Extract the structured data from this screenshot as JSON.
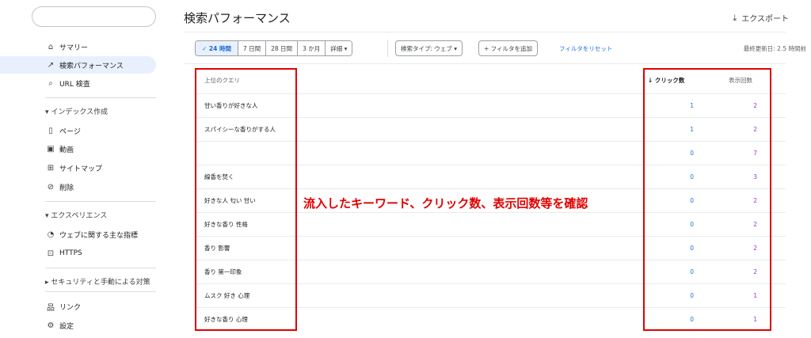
{
  "sidebar": {
    "search_placeholder": "",
    "items": [
      {
        "id": "summary",
        "label": "サマリー",
        "icon": "home-icon",
        "glyph": "⌂"
      },
      {
        "id": "performance",
        "label": "検索パフォーマンス",
        "icon": "trending-icon",
        "glyph": "↗"
      },
      {
        "id": "url-inspection",
        "label": "URL 検査",
        "icon": "search-icon",
        "glyph": "⌕"
      }
    ],
    "indexing": {
      "title": "インデックス作成",
      "items": [
        {
          "id": "pages",
          "label": "ページ",
          "icon": "pages-icon",
          "glyph": "▯"
        },
        {
          "id": "video",
          "label": "動画",
          "icon": "video-icon",
          "glyph": "▣"
        },
        {
          "id": "sitemaps",
          "label": "サイトマップ",
          "icon": "sitemap-icon",
          "glyph": "⊞"
        },
        {
          "id": "removals",
          "label": "削除",
          "icon": "removal-icon",
          "glyph": "⊘"
        }
      ]
    },
    "experience": {
      "title": "エクスペリエンス",
      "items": [
        {
          "id": "cwv",
          "label": "ウェブに関する主な指標",
          "icon": "gauge-icon",
          "glyph": "◔"
        },
        {
          "id": "https",
          "label": "HTTPS",
          "icon": "lock-icon",
          "glyph": "⊡"
        }
      ]
    },
    "security": {
      "title": "セキュリティと手動による対策"
    },
    "bottom": [
      {
        "id": "links",
        "label": "リンク",
        "icon": "links-icon",
        "glyph": "品"
      },
      {
        "id": "settings",
        "label": "設定",
        "icon": "gear-icon",
        "glyph": "⚙"
      }
    ]
  },
  "header": {
    "title": "検索パフォーマンス",
    "export_label": "エクスポート",
    "export_icon": "download-icon"
  },
  "filters": {
    "date_ranges": [
      "24 時間",
      "7 日間",
      "28 日間",
      "3 か月",
      "詳細"
    ],
    "selected_range": "24 時間",
    "search_type": "検索タイプ: ウェブ",
    "add_filter": "フィルタを追加",
    "reset": "フィルタをリセット",
    "last_updated": "最終更新日: 2.5 時間前"
  },
  "table": {
    "headers": {
      "query": "上位のクエリ",
      "clicks": "クリック数",
      "impressions": "表示回数"
    },
    "rows": [
      {
        "query": "甘い香りが好きな人",
        "clicks": "1",
        "impressions": "2"
      },
      {
        "query": "スパイシーな香りがする人",
        "clicks": "1",
        "impressions": "2"
      },
      {
        "query": "",
        "clicks": "0",
        "impressions": "7"
      },
      {
        "query": "線香を焚く",
        "clicks": "0",
        "impressions": "3"
      },
      {
        "query": "好きな人 匂い 甘い",
        "clicks": "0",
        "impressions": "2"
      },
      {
        "query": "好きな香り 性格",
        "clicks": "0",
        "impressions": "2"
      },
      {
        "query": "香り 影響",
        "clicks": "0",
        "impressions": "2"
      },
      {
        "query": "香り 第一印象",
        "clicks": "0",
        "impressions": "2"
      },
      {
        "query": "ムスク 好き 心理",
        "clicks": "0",
        "impressions": "1"
      },
      {
        "query": "好きな香り 心理",
        "clicks": "0",
        "impressions": "1"
      }
    ]
  },
  "annotation": {
    "text": "流入したキーワード、クリック数、表示回数等を確認",
    "color": "#e00000"
  },
  "colors": {
    "link": "#1a73e8",
    "clicks": "#1a73e8",
    "impressions": "#9334e6",
    "active_bg": "#e8f0fe"
  }
}
